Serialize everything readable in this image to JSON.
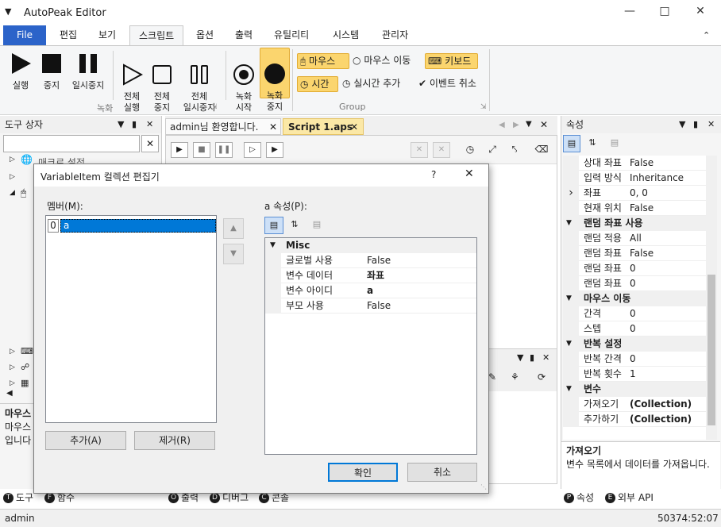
{
  "window": {
    "title": "AutoPeak Editor"
  },
  "ribbon": {
    "tabs": [
      "File",
      "편집",
      "보기",
      "스크립트",
      "옵션",
      "출력",
      "유틸리티",
      "시스템",
      "관리자"
    ],
    "active_tab": "스크립트",
    "record_group": {
      "label": "녹화",
      "buttons": [
        "실행",
        "중지",
        "일시중지",
        "전체\n실행",
        "전체\n중지",
        "전체\n일시중지",
        "녹화\n시작",
        "녹화\n중지"
      ]
    },
    "group2": {
      "label": "Group",
      "items": [
        "마우스",
        "마우스 이동",
        "키보드",
        "시간",
        "실시간 추가",
        "이벤트 취소"
      ]
    }
  },
  "toolbox": {
    "title": "도구 상자",
    "partial_item": "매크로 설정",
    "desc_title": "마우스",
    "desc_lines": [
      "마우스",
      "입니다"
    ]
  },
  "doc_tabs": {
    "tab1": "admin님 환영합니다.",
    "tab2": "Script 1.aps"
  },
  "properties_panel": {
    "title": "속성",
    "rows": [
      {
        "type": "prop",
        "name": "상대 좌표",
        "value": "False"
      },
      {
        "type": "prop",
        "name": "입력 방식",
        "value": "Inheritance"
      },
      {
        "type": "prop",
        "name": "좌표",
        "value": "0, 0",
        "expand": true
      },
      {
        "type": "prop",
        "name": "현재 위치",
        "value": "False"
      },
      {
        "type": "cat",
        "name": "랜덤 좌표 사용"
      },
      {
        "type": "prop",
        "name": "랜덤 적용",
        "value": "All"
      },
      {
        "type": "prop",
        "name": "랜덤 좌표",
        "value": "False"
      },
      {
        "type": "prop",
        "name": "랜덤 좌표",
        "value": "0"
      },
      {
        "type": "prop",
        "name": "랜덤 좌표",
        "value": "0"
      },
      {
        "type": "cat",
        "name": "마우스 이동"
      },
      {
        "type": "prop",
        "name": "간격",
        "value": "0"
      },
      {
        "type": "prop",
        "name": "스텝",
        "value": "0"
      },
      {
        "type": "cat",
        "name": "반복 설정"
      },
      {
        "type": "prop",
        "name": "반복 간격",
        "value": "0"
      },
      {
        "type": "prop",
        "name": "반복 횟수",
        "value": "1"
      },
      {
        "type": "cat",
        "name": "변수"
      },
      {
        "type": "prop",
        "name": "가져오기",
        "value": "(Collection)",
        "bold": true
      },
      {
        "type": "prop",
        "name": "추가하기",
        "value": "(Collection)",
        "bold": true
      }
    ],
    "desc_title": "가져오기",
    "desc_text": "변수 목록에서 데이터를 가져옵니다."
  },
  "bottom_left_tabs": [
    "도구",
    "함수"
  ],
  "bottom_left_icons": [
    "T",
    "F"
  ],
  "bottom_center_tabs": [
    "출력",
    "디버그",
    "콘솔"
  ],
  "bottom_center_icons": [
    "O",
    "D",
    "C"
  ],
  "bottom_right_tabs": [
    "속성",
    "외부 API"
  ],
  "bottom_right_icons": [
    "P",
    "E"
  ],
  "status": {
    "user": "admin",
    "time": "50374:52:07"
  },
  "dialog": {
    "title": "VariableItem 컬렉션 편집기",
    "help": "?",
    "members_label": "멤버(M):",
    "members": [
      {
        "index": "0",
        "name": "a"
      }
    ],
    "props_label": "a 속성(P):",
    "category": "Misc",
    "props": [
      {
        "name": "글로벌 사용",
        "value": "False"
      },
      {
        "name": "변수 데이터",
        "value": "좌표",
        "bold": true
      },
      {
        "name": "변수 아이디",
        "value": "a",
        "bold": true
      },
      {
        "name": "부모 사용",
        "value": "False"
      }
    ],
    "add_label": "추가(A)",
    "remove_label": "제거(R)",
    "ok_label": "확인",
    "cancel_label": "취소"
  }
}
